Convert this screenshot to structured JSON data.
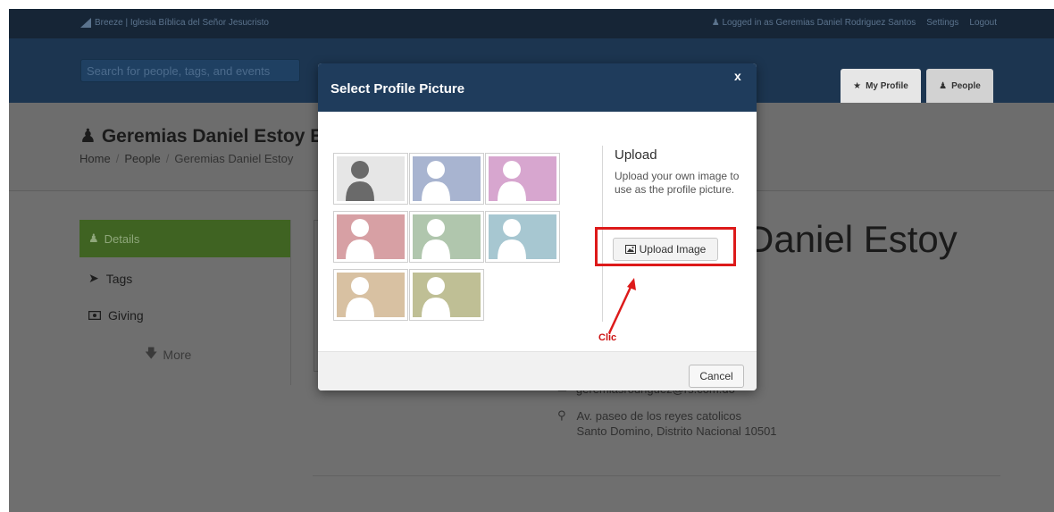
{
  "topbar": {
    "brand": "Breeze | Iglesia Bíblica del Señor Jesucristo",
    "logged_in": "Logged in as Geremias Daniel Rodriguez Santos",
    "settings": "Settings",
    "logout": "Logout"
  },
  "search": {
    "placeholder": "Search for people, tags, and events"
  },
  "tabs": {
    "my_profile": "My Profile",
    "people": "People"
  },
  "person": {
    "title": "Geremias Daniel Estoy E",
    "big_name": "Daniel Estoy",
    "email": "geremiasrodriguez@rs.com.do",
    "address_line1": "Av. paseo de los reyes catolicos",
    "address_line2": "Santo Domino, Distrito Nacional 10501"
  },
  "breadcrumb": {
    "home": "Home",
    "people": "People",
    "current": "Geremias Daniel Estoy"
  },
  "sidebar": {
    "items": [
      {
        "label": "Details",
        "icon": "user-icon",
        "active": true
      },
      {
        "label": "Tags",
        "icon": "tags-icon"
      },
      {
        "label": "Giving",
        "icon": "money-icon"
      }
    ],
    "more": "More"
  },
  "modal": {
    "title": "Select Profile Picture",
    "close": "x",
    "upload_title": "Upload",
    "upload_desc": "Upload your own image to use as the profile picture.",
    "upload_button": "Upload Image",
    "cancel_button": "Cancel",
    "annotation": "Clic",
    "avatars": [
      {
        "bg": "#e6e6e6",
        "fg": "#6a6a6a"
      },
      {
        "bg": "#a8b4d0",
        "fg": "#ffffff"
      },
      {
        "bg": "#d7a6cf",
        "fg": "#ffffff"
      },
      {
        "bg": "#d7a0a4",
        "fg": "#ffffff"
      },
      {
        "bg": "#b0c6ad",
        "fg": "#ffffff"
      },
      {
        "bg": "#a7c7d1",
        "fg": "#ffffff"
      },
      {
        "bg": "#d8c1a2",
        "fg": "#ffffff"
      },
      {
        "bg": "#bfbf95",
        "fg": "#ffffff"
      }
    ]
  },
  "colors": {
    "topbar": "#162536",
    "header": "#1c3550",
    "modal_header": "#1f3c5c",
    "sidebar_active": "#3f6322",
    "annotation_red": "#dd1a1a"
  }
}
